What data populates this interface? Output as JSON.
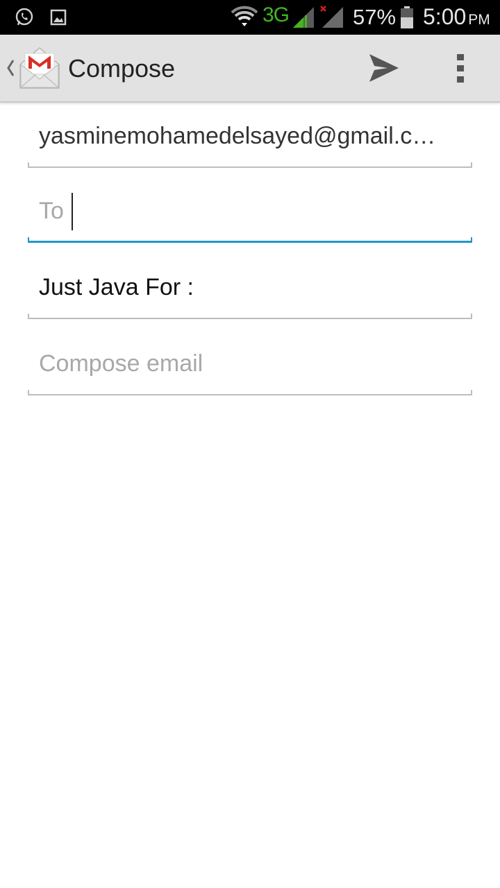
{
  "status_bar": {
    "network_type": "3G",
    "battery_percent": "57%",
    "time": "5:00",
    "time_period": "PM",
    "icons": [
      "whatsapp-icon",
      "gallery-icon",
      "wifi-icon",
      "signal-icon",
      "signal-no-data-icon",
      "battery-icon"
    ],
    "network_color": "#43b51f"
  },
  "action_bar": {
    "title": "Compose",
    "app_icon": "gmail-icon",
    "actions": [
      "send-icon",
      "overflow-menu-icon"
    ],
    "background": "#e2e2e2"
  },
  "compose": {
    "from": "yasminemohamedelsayed@gmail.c…",
    "to_placeholder": "To",
    "to_value": "",
    "subject_value": "Just Java For :",
    "body_placeholder": "Compose email",
    "body_value": "",
    "focus_color": "#1f97c9"
  }
}
